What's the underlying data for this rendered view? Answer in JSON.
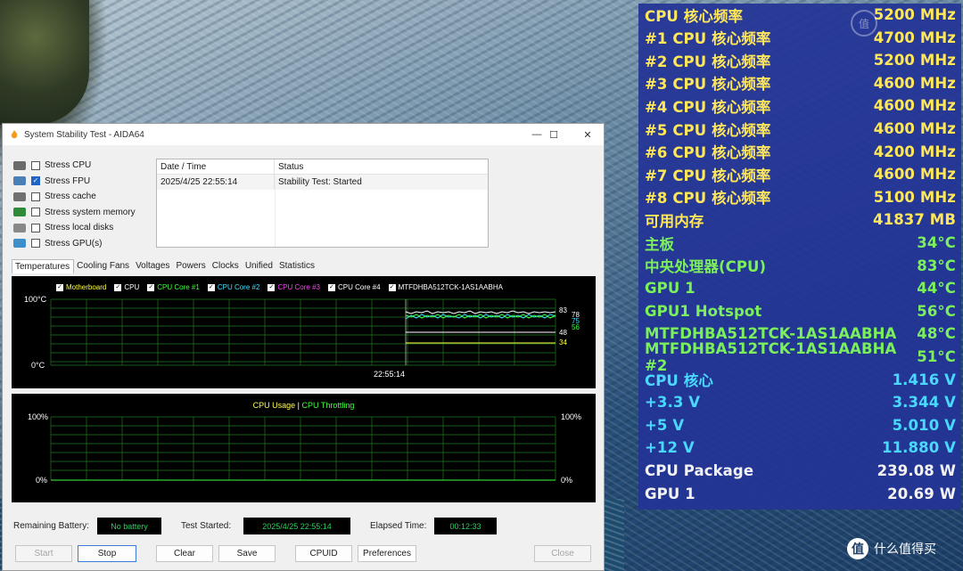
{
  "window": {
    "title": "System Stability Test - AIDA64",
    "controls": {
      "minimize": "—",
      "maximize": "☐",
      "close": "✕"
    }
  },
  "stress_options": [
    {
      "label": "Stress CPU",
      "checked": false,
      "icon": "cpu-chip-icon",
      "color": "#6b6b6b"
    },
    {
      "label": "Stress FPU",
      "checked": true,
      "icon": "fpu-stack-icon",
      "color": "#4a7fb8"
    },
    {
      "label": "Stress cache",
      "checked": false,
      "icon": "cache-chip-icon",
      "color": "#707070"
    },
    {
      "label": "Stress system memory",
      "checked": false,
      "icon": "memory-module-icon",
      "color": "#2f8a3a"
    },
    {
      "label": "Stress local disks",
      "checked": false,
      "icon": "disk-icon",
      "color": "#888888"
    },
    {
      "label": "Stress GPU(s)",
      "checked": false,
      "icon": "gpu-card-icon",
      "color": "#3c8fc8"
    }
  ],
  "log": {
    "headers": [
      "Date / Time",
      "Status"
    ],
    "rows": [
      [
        "2025/4/25 22:55:14",
        "Stability Test: Started"
      ]
    ]
  },
  "tabs": [
    "Temperatures",
    "Cooling Fans",
    "Voltages",
    "Powers",
    "Clocks",
    "Unified",
    "Statistics"
  ],
  "active_tab": "Temperatures",
  "temp_graph": {
    "legend": [
      {
        "label": "Motherboard",
        "color": "#ffff40"
      },
      {
        "label": "CPU",
        "color": "#ffffff"
      },
      {
        "label": "CPU Core #1",
        "color": "#40ff40"
      },
      {
        "label": "CPU Core #2",
        "color": "#40e0ff"
      },
      {
        "label": "CPU Core #3",
        "color": "#ff40ff"
      },
      {
        "label": "CPU Core #4",
        "color": "#ffffff"
      },
      {
        "label": "MTFDHBA512TCK-1AS1AABHA",
        "color": "#ffffff"
      }
    ],
    "y_top": "100°C",
    "y_bottom": "0°C",
    "time_label": "22:55:14",
    "end_values": [
      "83",
      "78",
      "75",
      "56",
      "48",
      "34"
    ]
  },
  "usage_graph": {
    "title_a": "CPU Usage",
    "separator": "|",
    "title_b": "CPU Throttling",
    "title_a_color": "#ffff40",
    "title_b_color": "#40ff40",
    "y_top_left": "100%",
    "y_bottom_left": "0%",
    "y_top_right": "100%",
    "y_bottom_right": "0%"
  },
  "status": {
    "battery_label": "Remaining Battery:",
    "battery_value": "No battery",
    "started_label": "Test Started:",
    "started_value": "2025/4/25 22:55:14",
    "elapsed_label": "Elapsed Time:",
    "elapsed_value": "00:12:33"
  },
  "buttons": {
    "start": "Start",
    "stop": "Stop",
    "clear": "Clear",
    "save": "Save",
    "cpuid": "CPUID",
    "preferences": "Preferences",
    "close": "Close"
  },
  "osd": [
    {
      "label": "CPU 核心频率",
      "value": "5200 MHz",
      "color": "#ffe75a"
    },
    {
      "label": "#1 CPU 核心频率",
      "value": "4700 MHz",
      "color": "#ffe75a"
    },
    {
      "label": "#2 CPU 核心频率",
      "value": "5200 MHz",
      "color": "#ffe75a"
    },
    {
      "label": "#3 CPU 核心频率",
      "value": "4600 MHz",
      "color": "#ffe75a"
    },
    {
      "label": "#4 CPU 核心频率",
      "value": "4600 MHz",
      "color": "#ffe75a"
    },
    {
      "label": "#5 CPU 核心频率",
      "value": "4600 MHz",
      "color": "#ffe75a"
    },
    {
      "label": "#6 CPU 核心频率",
      "value": "4200 MHz",
      "color": "#ffe75a"
    },
    {
      "label": "#7 CPU 核心频率",
      "value": "4600 MHz",
      "color": "#ffe75a"
    },
    {
      "label": "#8 CPU 核心频率",
      "value": "5100 MHz",
      "color": "#ffe75a"
    },
    {
      "label": "可用内存",
      "value": "41837 MB",
      "color": "#ffe75a"
    },
    {
      "label": "主板",
      "value": "34°C",
      "color": "#7bf05c"
    },
    {
      "label": "中央处理器(CPU)",
      "value": "83°C",
      "color": "#7bf05c"
    },
    {
      "label": "GPU 1",
      "value": "44°C",
      "color": "#7bf05c"
    },
    {
      "label": "GPU1 Hotspot",
      "value": "56°C",
      "color": "#7bf05c"
    },
    {
      "label": "MTFDHBA512TCK-1AS1AABHA",
      "value": "48°C",
      "color": "#7bf05c"
    },
    {
      "label": "MTFDHBA512TCK-1AS1AABHA #2",
      "value": "51°C",
      "color": "#7bf05c"
    },
    {
      "label": "CPU 核心",
      "value": "1.416 V",
      "color": "#49d8ff"
    },
    {
      "label": "+3.3 V",
      "value": "3.344 V",
      "color": "#49d8ff"
    },
    {
      "label": "+5 V",
      "value": "5.010 V",
      "color": "#49d8ff"
    },
    {
      "label": "+12 V",
      "value": "11.880 V",
      "color": "#49d8ff"
    },
    {
      "label": "CPU Package",
      "value": "239.08 W",
      "color": "#f2f2f2"
    },
    {
      "label": "GPU 1",
      "value": "20.69 W",
      "color": "#f2f2f2"
    }
  ],
  "watermark": {
    "logo": "值",
    "text": "什么值得买"
  }
}
